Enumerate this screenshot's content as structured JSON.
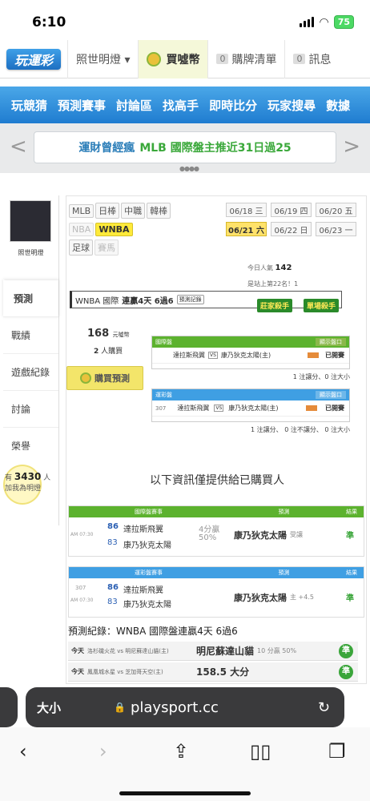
{
  "status": {
    "time": "6:10",
    "battery": "75"
  },
  "topnav": {
    "logo": "玩運彩",
    "ritual": "照世明燈 ▾",
    "buy_coin": "買噓幣",
    "cart_count": "0",
    "cart": "購牌清單",
    "msg_count": "0",
    "msg": "訊息"
  },
  "bluenav": [
    "玩競猜",
    "預測賽事",
    "討論區",
    "找高手",
    "即時比分",
    "玩家搜尋",
    "數據"
  ],
  "banner": {
    "left": "運財曾經瘋",
    "highlight": "MLB 國際盤主推近31日過25",
    "prev": "<",
    "next": ">"
  },
  "sidebar": {
    "name": "照世明燈",
    "items": [
      "預測",
      "戰績",
      "遊戲紀錄",
      "討論",
      "榮譽"
    ],
    "fans_prefix": "有",
    "fans_count": "3430",
    "fans_suffix": "人",
    "fans_note": "加我為明燈"
  },
  "leagues": {
    "row1": [
      "MLB",
      "日棒",
      "中職",
      "韓棒"
    ],
    "nba": "NBA",
    "wnba": "WNBA",
    "soccer": "足球",
    "horse": "賽馬"
  },
  "dates": [
    "06/18 三",
    "06/19 四",
    "06/20 五",
    "06/21 六",
    "06/22 日",
    "06/23 一"
  ],
  "popularity": {
    "label": "今日人氣",
    "count": "142",
    "rank": "是站上第22名！1"
  },
  "predict": {
    "title_a": "WNBA 國際",
    "title_b": "連贏4天 6過6",
    "record_btn": "預測記錄",
    "badge1": "莊家殺手",
    "badge2": "單場殺手",
    "price": "168",
    "price_unit": "元噓幣",
    "buyers": "2",
    "buyers_unit": "人購買",
    "buy_btn": "購買預測"
  },
  "intl": {
    "head": "國際盤",
    "show_odds": "顯示盤口",
    "away": "達拉斯飛翼",
    "vs": "VS",
    "home": "康乃狄克太陽(主)",
    "paid": "已開賽",
    "note": "1 注讓分、0 注大小"
  },
  "sport": {
    "head": "運彩盤",
    "show_odds": "顯示盤口",
    "num": "307",
    "away": "達拉斯飛翼",
    "vs": "VS",
    "home": "康乃狄克太陽(主)",
    "paid": "已開賽",
    "note": "1 注讓分、 0 注不讓分、 0 注大小"
  },
  "info_text": "以下資訊僅提供給已購買人",
  "table1": {
    "head": "國際盤賽事",
    "pred_head": "預測",
    "result_head": "結果",
    "time": "AM 07:30",
    "away_score": "86",
    "away": "達拉斯飛翼",
    "home_score": "83",
    "home": "康乃狄克太陽",
    "spread": "4分贏",
    "spread_pct": "50%",
    "pick": "康乃狄克太陽",
    "pick_note": "受讓",
    "result": "準"
  },
  "table2": {
    "head": "運彩盤賽事",
    "pred_head": "預測",
    "result_head": "結果",
    "num": "307",
    "time": "AM 07:30",
    "away_score": "86",
    "away": "達拉斯飛翼",
    "home_score": "83",
    "home": "康乃狄克太陽",
    "pick": "康乃狄克太陽",
    "pick_note": "主 +4.5",
    "result": "準"
  },
  "records": {
    "title": "預測紀錄：WNBA 國際盤連贏4天 6過6",
    "rows": [
      {
        "day": "今天",
        "teams": "洛杉磯火花 vs 明尼蘇達山貓(主)",
        "pick": "明尼蘇達山貓",
        "note": "10 分贏 50%",
        "result": "準"
      },
      {
        "day": "今天",
        "teams": "鳳凰城水星 vs 芝加哥天空(主)",
        "pick": "158.5 大分",
        "note": "",
        "result": "準"
      }
    ]
  },
  "browser": {
    "aa": "大小",
    "url": "playsport.cc"
  }
}
